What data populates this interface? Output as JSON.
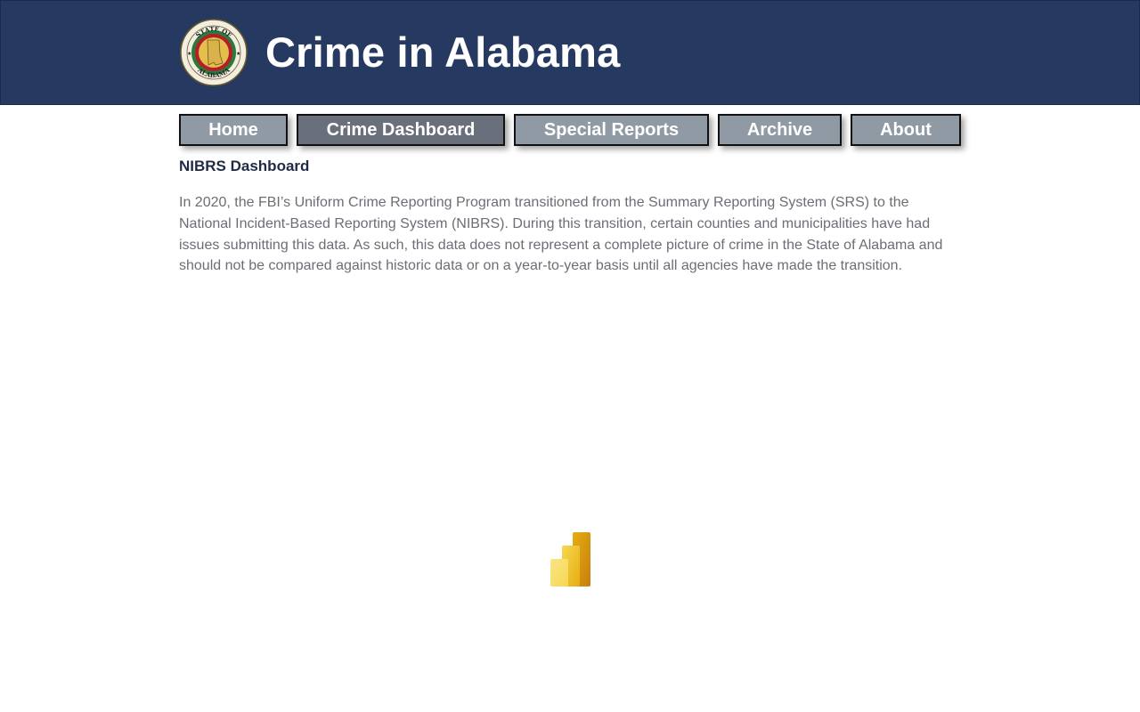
{
  "header": {
    "title": "Crime in Alabama",
    "seal_icon": "state-of-alabama-seal-icon",
    "seal_top_text": "STATE OF",
    "seal_bottom_text": "ALABAMA",
    "background_color": "#263a61"
  },
  "nav": {
    "items": [
      {
        "label": "Home",
        "active": false
      },
      {
        "label": "Crime Dashboard",
        "active": true
      },
      {
        "label": "Special Reports",
        "active": false
      },
      {
        "label": "Archive",
        "active": false
      },
      {
        "label": "About",
        "active": false
      }
    ],
    "button_color": "#8f9aa4",
    "active_button_color": "#6a6f7c"
  },
  "main": {
    "section_title": "NIBRS Dashboard",
    "notice": "In 2020, the FBI’s Uniform Crime Reporting Program transitioned from the Summary Reporting System (SRS) to the National Incident-Based Reporting System (NIBRS). During this transition, certain counties and municipalities have had issues submitting this data. As such, this data does not represent a complete picture of crime in the State of Alabama and should not be compared against historic data or on a year-to-year basis until all agencies have made the transition.",
    "embed_loading_icon": "power-bi-logo-icon"
  }
}
